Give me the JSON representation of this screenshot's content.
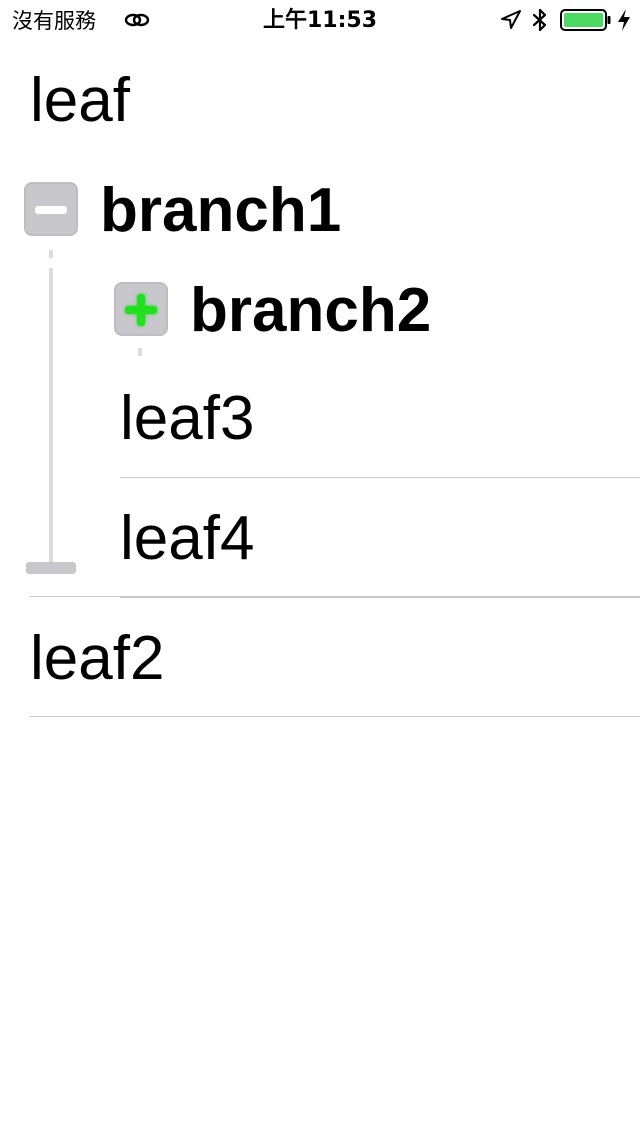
{
  "status_bar": {
    "carrier": "沒有服務",
    "time": "上午11:53",
    "link_icon": "link-icon",
    "location_icon": "location-arrow-icon",
    "bluetooth_icon": "bluetooth-icon",
    "battery_icon": "battery-icon",
    "charging_icon": "charging-bolt-icon",
    "battery_color": "#4cd964"
  },
  "tree": {
    "nodes": [
      {
        "label": "leaf",
        "type": "leaf",
        "depth": 0
      },
      {
        "label": "branch1",
        "type": "branch",
        "depth": 0,
        "expanded": true,
        "toggle_icon": "collapse-minus-icon"
      },
      {
        "label": "branch2",
        "type": "branch",
        "depth": 1,
        "expanded": false,
        "toggle_icon": "expand-plus-icon"
      },
      {
        "label": "leaf3",
        "type": "leaf",
        "depth": 1
      },
      {
        "label": "leaf4",
        "type": "leaf",
        "depth": 1
      },
      {
        "label": "leaf2",
        "type": "leaf",
        "depth": 0
      }
    ],
    "colors": {
      "toggle_background": "#c7c7cc",
      "expand_plus": "#22e01f",
      "collapse_minus": "#ffffff",
      "separator": "#c8c7cc",
      "guide_line": "#dcdce0"
    }
  }
}
